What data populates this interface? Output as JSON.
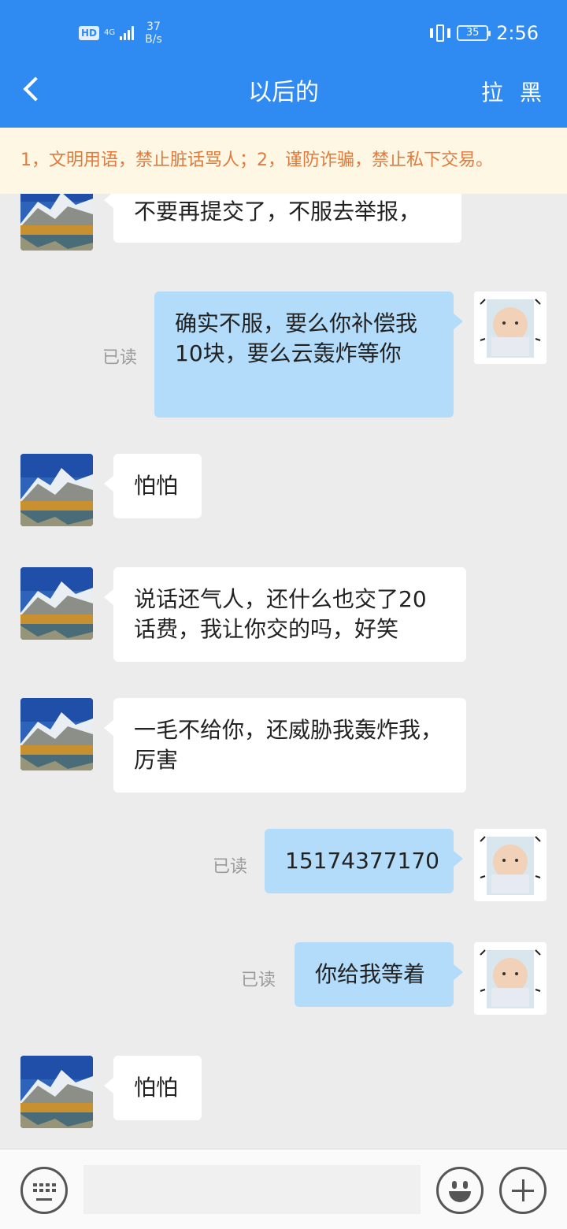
{
  "status_bar": {
    "hd": "HD",
    "network": "4G",
    "speed_value": "37",
    "speed_unit": "B/s",
    "battery": "35",
    "time": "2:56"
  },
  "header": {
    "title": "以后的",
    "block_label": "拉 黑"
  },
  "notice": "1，文明用语，禁止脏话骂人；2，谨防诈骗，禁止私下交易。",
  "messages": [
    {
      "side": "left",
      "text": "不要再提交了，不服去举报，"
    },
    {
      "side": "right",
      "text": "确实不服，要么你补偿我10块，要么云轰炸等你",
      "read": "已读"
    },
    {
      "side": "left",
      "text": "怕怕"
    },
    {
      "side": "left",
      "text": "说话还气人，还什么也交了20话费，我让你交的吗，好笑"
    },
    {
      "side": "left",
      "text": "一毛不给你，还威胁我轰炸我，厉害"
    },
    {
      "side": "right",
      "text": "15174377170",
      "read": "已读"
    },
    {
      "side": "right",
      "text": "你给我等着",
      "read": "已读"
    },
    {
      "side": "left",
      "text": "怕怕"
    }
  ],
  "input": {
    "value": "",
    "placeholder": ""
  },
  "colors": {
    "header_bg": "#2f8af2",
    "notice_bg": "#fdf7e3",
    "notice_text": "#e07b3f",
    "outgoing_bubble": "#b3dcfb",
    "incoming_bubble": "#ffffff",
    "chat_bg": "#ececec"
  }
}
